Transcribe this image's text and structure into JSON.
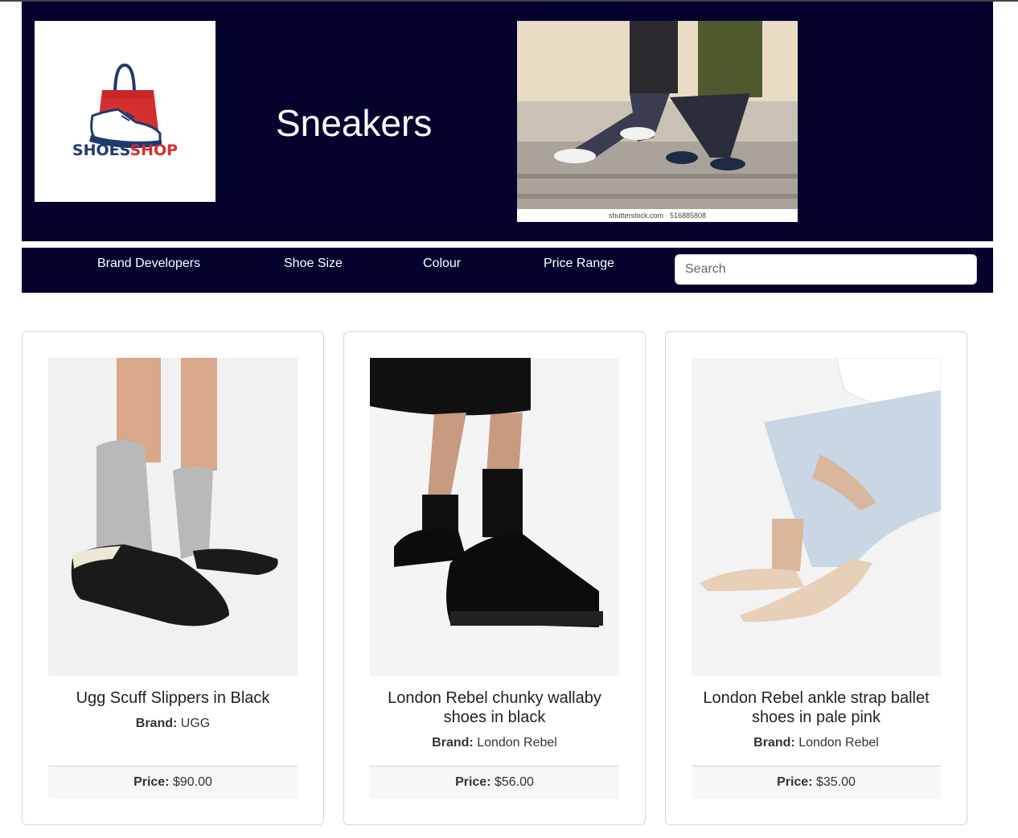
{
  "header": {
    "logo_text_part1": "SHOES",
    "logo_text_part2": "SHOP",
    "title": "Sneakers",
    "hero_credit": "shutterstock.com · 516885808"
  },
  "nav": {
    "items": [
      {
        "label": "Brand Developers"
      },
      {
        "label": "Shoe Size"
      },
      {
        "label": "Colour"
      },
      {
        "label": "Price Range"
      }
    ],
    "search_placeholder": "Search"
  },
  "products": [
    {
      "name": "Ugg Scuff Slippers in Black",
      "brand_label": "Brand:",
      "brand": "UGG",
      "price_label": "Price:",
      "price": "$90.00"
    },
    {
      "name": "London Rebel chunky wallaby shoes in black",
      "brand_label": "Brand:",
      "brand": "London Rebel",
      "price_label": "Price:",
      "price": "$56.00"
    },
    {
      "name": "London Rebel ankle strap ballet shoes in pale pink",
      "brand_label": "Brand:",
      "brand": "London Rebel",
      "price_label": "Price:",
      "price": "$35.00"
    }
  ],
  "colors": {
    "header_bg": "#03032e",
    "logo_red": "#d32f2f",
    "logo_navy": "#1f3a6e"
  }
}
